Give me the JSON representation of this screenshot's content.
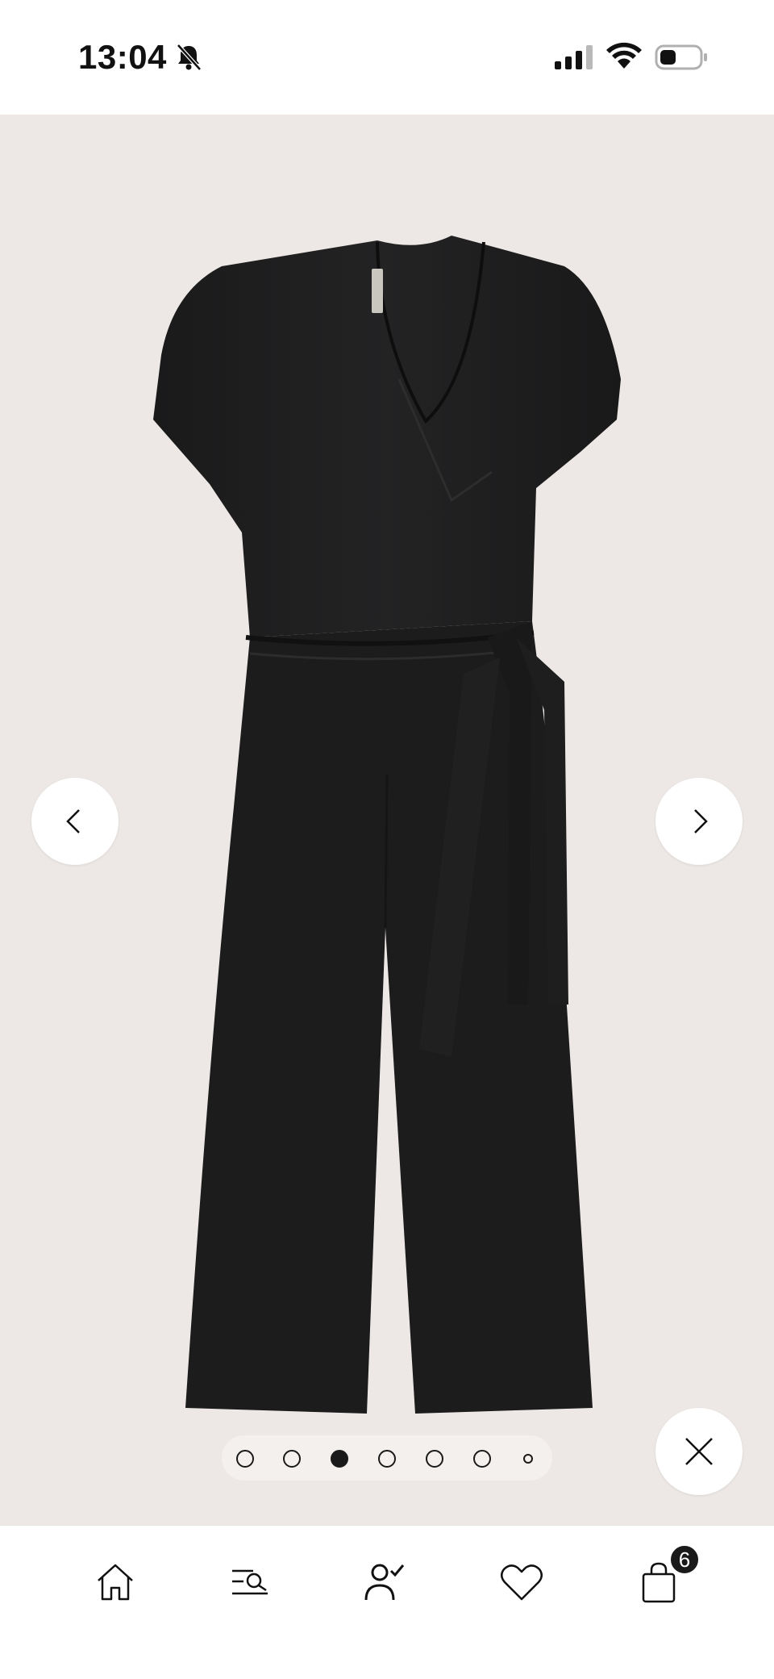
{
  "status_bar": {
    "time": "13:04",
    "icons": [
      "bell-slash-icon",
      "signal-icon",
      "wifi-icon",
      "battery-icon"
    ]
  },
  "gallery": {
    "background_color": "#ede8e5",
    "product_color": "#1c1c1d",
    "image_count": 7,
    "active_index": 2,
    "prev_icon": "chevron-left-icon",
    "next_icon": "chevron-right-icon",
    "close_icon": "close-icon"
  },
  "tab_bar": {
    "tabs": [
      {
        "name": "home",
        "icon": "home-icon"
      },
      {
        "name": "search",
        "icon": "search-menu-icon"
      },
      {
        "name": "account",
        "icon": "user-check-icon"
      },
      {
        "name": "favorites",
        "icon": "heart-icon"
      },
      {
        "name": "bag",
        "icon": "shopping-bag-icon"
      }
    ],
    "bag_count": "6"
  }
}
